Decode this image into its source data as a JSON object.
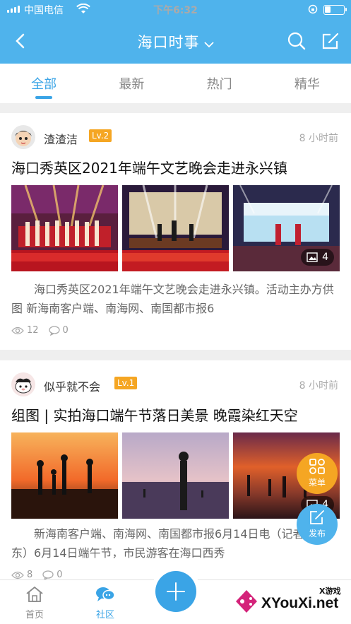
{
  "status_bar": {
    "carrier": "中国电信",
    "time": "下午6:32"
  },
  "nav": {
    "title": "海口时事"
  },
  "tabs": [
    {
      "label": "全部",
      "active": true
    },
    {
      "label": "最新",
      "active": false
    },
    {
      "label": "热门",
      "active": false
    },
    {
      "label": "精华",
      "active": false
    }
  ],
  "posts": [
    {
      "username": "渣渣洁",
      "level": "Lv.2",
      "time": "8 小时前",
      "title": "海口秀英区2021年端午文艺晚会走进永兴镇",
      "image_count": "4",
      "excerpt": "海口秀英区2021年端午文艺晚会走进永兴镇。活动主办方供图 新海南客户端、南海网、南国都市报6",
      "views": "12",
      "comments": "0"
    },
    {
      "username": "似乎就不会",
      "level": "Lv.1",
      "time": "8 小时前",
      "title": "组图 | 实拍海口端午节落日美景 晚霞染红天空",
      "image_count": "4",
      "excerpt": "新海南客户端、南海网、南国都市报6月14日电（记者 陈卫东）6月14日端午节，市民游客在海口西秀",
      "views": "8",
      "comments": "0"
    }
  ],
  "fab": {
    "menu_label": "菜单",
    "post_label": "发布"
  },
  "bottom_nav": [
    {
      "label": "首页",
      "active": false
    },
    {
      "label": "社区",
      "active": true
    }
  ],
  "watermark": {
    "small": "X游戏",
    "big": "XYouXi.net"
  },
  "colors": {
    "primary": "#4fb3ec",
    "accent": "#3aa4e6",
    "level_badge": "#f5a623"
  }
}
